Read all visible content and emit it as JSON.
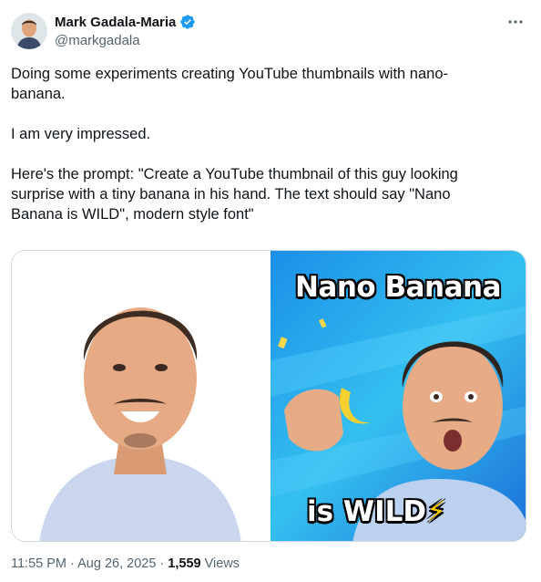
{
  "author": {
    "name": "Mark Gadala-Maria",
    "handle": "@markgadala",
    "verified": true,
    "verified_color": "#1d9bf0"
  },
  "tweet": {
    "text": "Doing some experiments creating YouTube thumbnails with nano-\nbanana.\n\nI am very impressed.\n\nHere's the prompt: \"Create a YouTube thumbnail of this guy looking\nsurprise with a tiny banana in his hand. The text should say \"Nano\nBanana is WILD\", modern style font\"",
    "time": "11:55 PM",
    "separator": "·",
    "date": "Aug 26, 2025",
    "views_count": "1,559",
    "views_label": "Views"
  },
  "media": {
    "thumbnail_title": "Nano Banana",
    "thumbnail_subtitle": "is WILD",
    "thumbnail_icon": "⚡"
  },
  "icons": {
    "more": "more-dots-icon",
    "verified": "verified-badge-icon"
  }
}
